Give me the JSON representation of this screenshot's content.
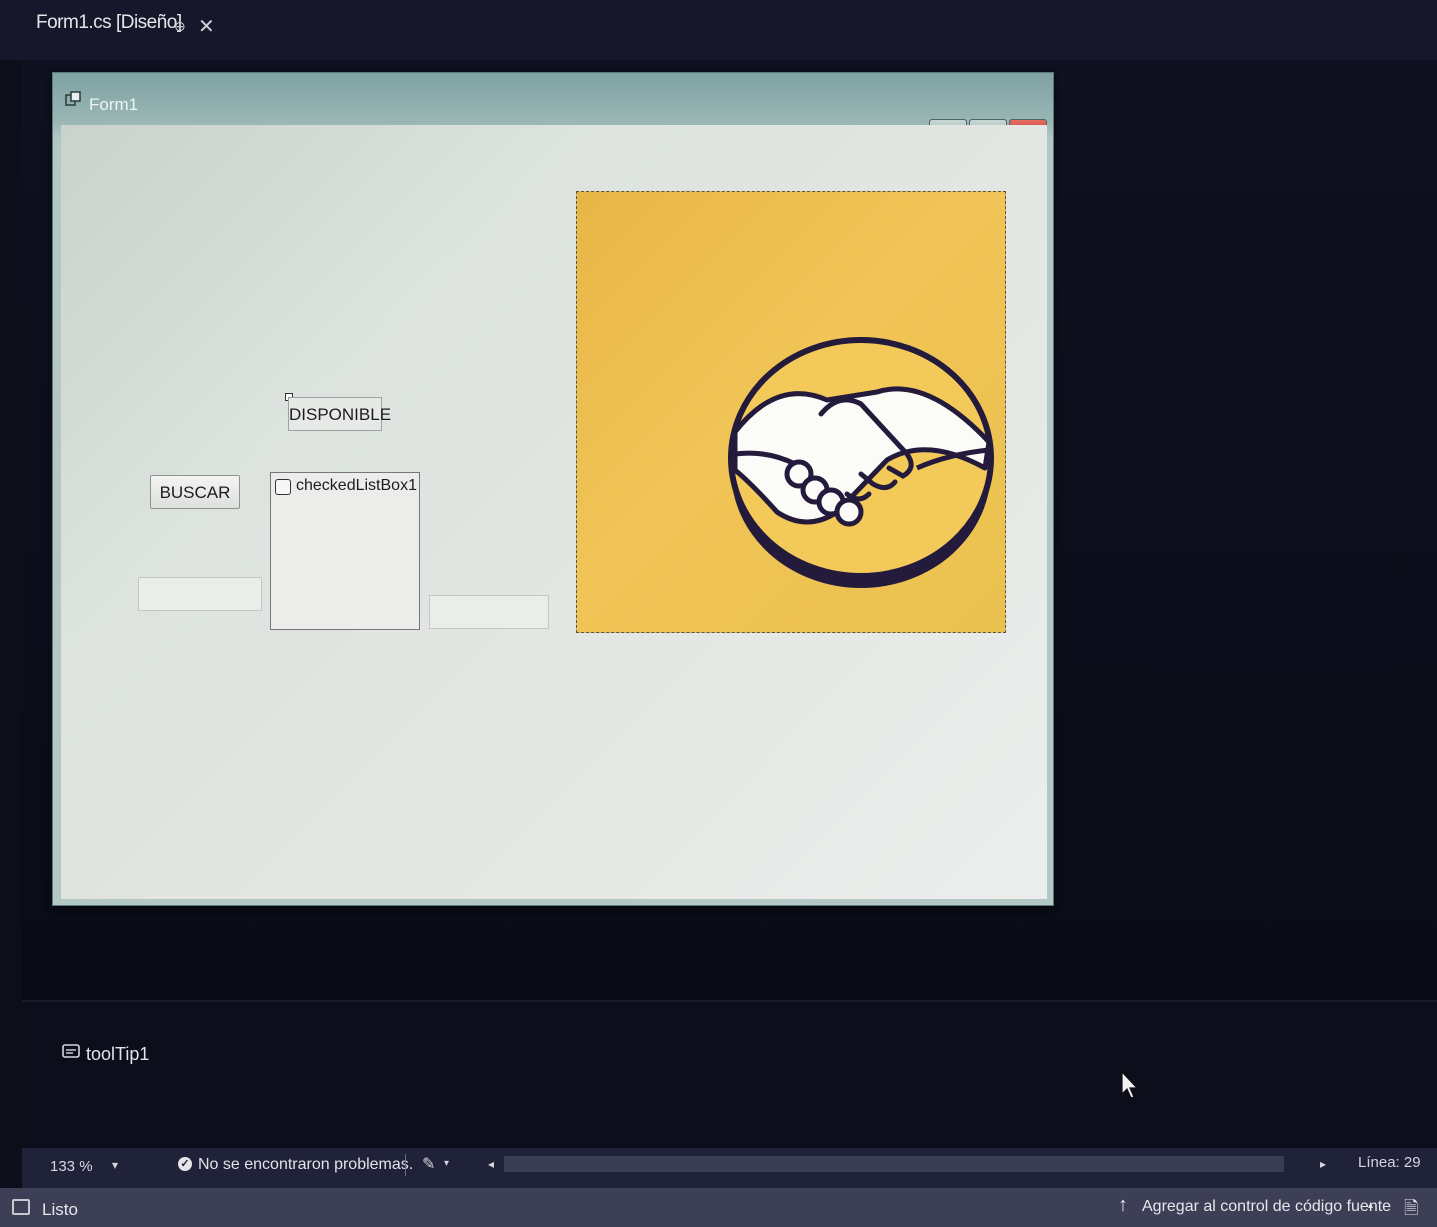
{
  "document_tab": {
    "title": "Form1.cs [Diseño]"
  },
  "form": {
    "title": "Form1",
    "controls": {
      "disponible_label": "DISPONIBLE",
      "buscar_button": "BUSCAR",
      "checked_list_item": "checkedListBox1"
    }
  },
  "component_tray": {
    "tooltip": "toolTip1"
  },
  "editor_bar": {
    "zoom": "133 %",
    "issues": "No se encontraron problemas.",
    "line": "Línea: 29"
  },
  "status_bar": {
    "status": "Listo",
    "source_control": "Agregar al control de código fuente"
  },
  "colors": {
    "picture_background": "#f0c456",
    "logo_outline": "#231a3c",
    "ide_background": "#0d0e1a"
  },
  "icons": [
    "pin-icon",
    "close-icon",
    "form-app-icon",
    "minimize-icon",
    "maximize-icon",
    "checkbox-icon",
    "handshake-icon",
    "tooltip-icon",
    "check-circle-icon",
    "cleanup-icon",
    "source-control-icon",
    "notification-icon",
    "mouse-cursor-icon"
  ]
}
